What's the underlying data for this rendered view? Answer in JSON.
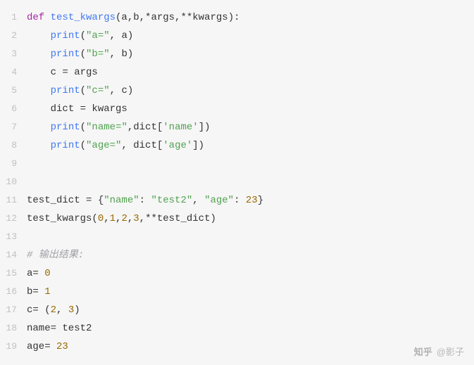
{
  "watermark": {
    "brand": "知乎",
    "author": "@影子"
  },
  "code": {
    "lines": [
      {
        "n": 1,
        "tokens": [
          [
            "kw",
            "def "
          ],
          [
            "fn",
            "test_kwargs"
          ],
          [
            "pr",
            "(a,b,"
          ],
          [
            "pr",
            "*"
          ],
          [
            "pr",
            "args,"
          ],
          [
            "pr",
            "**"
          ],
          [
            "pr",
            "kwargs):"
          ]
        ]
      },
      {
        "n": 2,
        "indent": 1,
        "tokens": [
          [
            "fn",
            "print"
          ],
          [
            "pr",
            "("
          ],
          [
            "st",
            "\"a=\""
          ],
          [
            "pr",
            ", a)"
          ]
        ]
      },
      {
        "n": 3,
        "indent": 1,
        "tokens": [
          [
            "fn",
            "print"
          ],
          [
            "pr",
            "("
          ],
          [
            "st",
            "\"b=\""
          ],
          [
            "pr",
            ", b)"
          ]
        ]
      },
      {
        "n": 4,
        "indent": 1,
        "tokens": [
          [
            "pr",
            "c = args"
          ]
        ]
      },
      {
        "n": 5,
        "indent": 1,
        "tokens": [
          [
            "fn",
            "print"
          ],
          [
            "pr",
            "("
          ],
          [
            "st",
            "\"c=\""
          ],
          [
            "pr",
            ", c)"
          ]
        ]
      },
      {
        "n": 6,
        "indent": 1,
        "tokens": [
          [
            "pr",
            "dict = kwargs"
          ]
        ]
      },
      {
        "n": 7,
        "indent": 1,
        "tokens": [
          [
            "fn",
            "print"
          ],
          [
            "pr",
            "("
          ],
          [
            "st",
            "\"name=\""
          ],
          [
            "pr",
            ",dict["
          ],
          [
            "st",
            "'name'"
          ],
          [
            "pr",
            "])"
          ]
        ]
      },
      {
        "n": 8,
        "indent": 1,
        "tokens": [
          [
            "fn",
            "print"
          ],
          [
            "pr",
            "("
          ],
          [
            "st",
            "\"age=\""
          ],
          [
            "pr",
            ", dict["
          ],
          [
            "st",
            "'age'"
          ],
          [
            "pr",
            "])"
          ]
        ]
      },
      {
        "n": 9,
        "tokens": []
      },
      {
        "n": 10,
        "tokens": []
      },
      {
        "n": 11,
        "tokens": [
          [
            "pr",
            "test_dict = {"
          ],
          [
            "st",
            "\"name\""
          ],
          [
            "pr",
            ": "
          ],
          [
            "st",
            "\"test2\""
          ],
          [
            "pr",
            ", "
          ],
          [
            "st",
            "\"age\""
          ],
          [
            "pr",
            ": "
          ],
          [
            "nu",
            "23"
          ],
          [
            "pr",
            "}"
          ]
        ]
      },
      {
        "n": 12,
        "tokens": [
          [
            "pr",
            "test_kwargs("
          ],
          [
            "nu",
            "0"
          ],
          [
            "pr",
            ","
          ],
          [
            "nu",
            "1"
          ],
          [
            "pr",
            ","
          ],
          [
            "nu",
            "2"
          ],
          [
            "pr",
            ","
          ],
          [
            "nu",
            "3"
          ],
          [
            "pr",
            ",**test_dict)"
          ]
        ]
      },
      {
        "n": 13,
        "tokens": []
      },
      {
        "n": 14,
        "tokens": [
          [
            "cm",
            "# 输出结果:"
          ]
        ]
      },
      {
        "n": 15,
        "tokens": [
          [
            "pr",
            "a= "
          ],
          [
            "nu",
            "0"
          ]
        ]
      },
      {
        "n": 16,
        "tokens": [
          [
            "pr",
            "b= "
          ],
          [
            "nu",
            "1"
          ]
        ]
      },
      {
        "n": 17,
        "tokens": [
          [
            "pr",
            "c= ("
          ],
          [
            "nu",
            "2"
          ],
          [
            "pr",
            ", "
          ],
          [
            "nu",
            "3"
          ],
          [
            "pr",
            ")"
          ]
        ]
      },
      {
        "n": 18,
        "tokens": [
          [
            "pr",
            "name= test2"
          ]
        ]
      },
      {
        "n": 19,
        "tokens": [
          [
            "pr",
            "age= "
          ],
          [
            "nu",
            "23"
          ]
        ]
      }
    ]
  }
}
